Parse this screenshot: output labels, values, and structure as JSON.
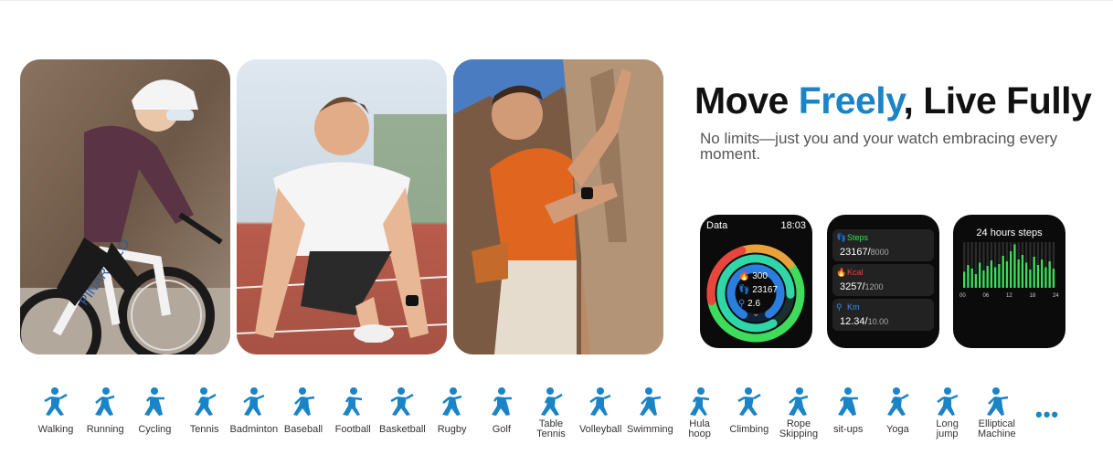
{
  "colors": {
    "accent": "#1b84c6",
    "watch_bg": "#0b0b0b",
    "steps_green": "#3ddc5a",
    "kcal_red": "#e8453c",
    "km_blue": "#3b8fe8"
  },
  "photos": [
    {
      "name": "cyclist-photo",
      "wheel_text": "PINARELLO"
    },
    {
      "name": "sprinter-photo"
    },
    {
      "name": "climber-photo"
    }
  ],
  "headline": {
    "part1": "Move ",
    "accent": "Freely",
    "part2": ", Live Fully"
  },
  "subline": "No limits—just you and your watch embracing every moment.",
  "watch_data": {
    "title": "Data",
    "time": "18:03",
    "kcal": "300",
    "steps": "23167",
    "km": "2.6"
  },
  "watch_cards": [
    {
      "icon": "footsteps-icon",
      "glyph": "👣",
      "label": "Steps",
      "value": "23167/",
      "target": "8000",
      "color": "#3ddc5a"
    },
    {
      "icon": "flame-icon",
      "glyph": "🔥",
      "label": "Kcal",
      "value": "3257/",
      "target": "1200",
      "color": "#e8453c"
    },
    {
      "icon": "location-pin-icon",
      "glyph": "⚲",
      "label": "Km",
      "value": "12.34/",
      "target": "10.00",
      "color": "#3b8fe8"
    }
  ],
  "watch_hist": {
    "title": "24 hours steps",
    "ticks": [
      "00",
      "06",
      "12",
      "18",
      "24"
    ],
    "levels": [
      0.35,
      0.5,
      0.42,
      0.3,
      0.55,
      0.38,
      0.48,
      0.6,
      0.45,
      0.52,
      0.7,
      0.58,
      0.8,
      0.95,
      0.62,
      0.72,
      0.55,
      0.4,
      0.68,
      0.5,
      0.62,
      0.45,
      0.58,
      0.42
    ]
  },
  "activities": [
    {
      "label": "Walking",
      "icon": "walking-icon"
    },
    {
      "label": "Running",
      "icon": "running-icon"
    },
    {
      "label": "Cycling",
      "icon": "cycling-icon"
    },
    {
      "label": "Tennis",
      "icon": "tennis-icon"
    },
    {
      "label": "Badminton",
      "icon": "badminton-icon"
    },
    {
      "label": "Baseball",
      "icon": "baseball-icon"
    },
    {
      "label": "Football",
      "icon": "football-icon"
    },
    {
      "label": "Basketball",
      "icon": "basketball-icon"
    },
    {
      "label": "Rugby",
      "icon": "rugby-icon"
    },
    {
      "label": "Golf",
      "icon": "golf-icon"
    },
    {
      "label": "Table\nTennis",
      "icon": "table-tennis-icon"
    },
    {
      "label": "Volleyball",
      "icon": "volleyball-icon"
    },
    {
      "label": "Swimming",
      "icon": "swimming-icon"
    },
    {
      "label": "Hula\nhoop",
      "icon": "hula-hoop-icon"
    },
    {
      "label": "Climbing",
      "icon": "climbing-icon"
    },
    {
      "label": "Rope\nSkipping",
      "icon": "rope-skipping-icon"
    },
    {
      "label": "sit-ups",
      "icon": "sit-ups-icon"
    },
    {
      "label": "Yoga",
      "icon": "yoga-icon"
    },
    {
      "label": "Long\njump",
      "icon": "long-jump-icon"
    },
    {
      "label": "Elliptical\nMachine",
      "icon": "elliptical-machine-icon"
    }
  ],
  "more_label": "•••"
}
